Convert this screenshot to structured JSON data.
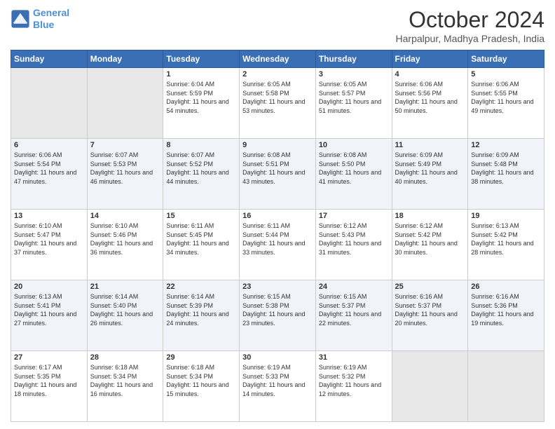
{
  "header": {
    "logo_line1": "General",
    "logo_line2": "Blue",
    "month": "October 2024",
    "location": "Harpalpur, Madhya Pradesh, India"
  },
  "weekdays": [
    "Sunday",
    "Monday",
    "Tuesday",
    "Wednesday",
    "Thursday",
    "Friday",
    "Saturday"
  ],
  "weeks": [
    [
      {
        "day": "",
        "info": ""
      },
      {
        "day": "",
        "info": ""
      },
      {
        "day": "1",
        "info": "Sunrise: 6:04 AM\nSunset: 5:59 PM\nDaylight: 11 hours and 54 minutes."
      },
      {
        "day": "2",
        "info": "Sunrise: 6:05 AM\nSunset: 5:58 PM\nDaylight: 11 hours and 53 minutes."
      },
      {
        "day": "3",
        "info": "Sunrise: 6:05 AM\nSunset: 5:57 PM\nDaylight: 11 hours and 51 minutes."
      },
      {
        "day": "4",
        "info": "Sunrise: 6:06 AM\nSunset: 5:56 PM\nDaylight: 11 hours and 50 minutes."
      },
      {
        "day": "5",
        "info": "Sunrise: 6:06 AM\nSunset: 5:55 PM\nDaylight: 11 hours and 49 minutes."
      }
    ],
    [
      {
        "day": "6",
        "info": "Sunrise: 6:06 AM\nSunset: 5:54 PM\nDaylight: 11 hours and 47 minutes."
      },
      {
        "day": "7",
        "info": "Sunrise: 6:07 AM\nSunset: 5:53 PM\nDaylight: 11 hours and 46 minutes."
      },
      {
        "day": "8",
        "info": "Sunrise: 6:07 AM\nSunset: 5:52 PM\nDaylight: 11 hours and 44 minutes."
      },
      {
        "day": "9",
        "info": "Sunrise: 6:08 AM\nSunset: 5:51 PM\nDaylight: 11 hours and 43 minutes."
      },
      {
        "day": "10",
        "info": "Sunrise: 6:08 AM\nSunset: 5:50 PM\nDaylight: 11 hours and 41 minutes."
      },
      {
        "day": "11",
        "info": "Sunrise: 6:09 AM\nSunset: 5:49 PM\nDaylight: 11 hours and 40 minutes."
      },
      {
        "day": "12",
        "info": "Sunrise: 6:09 AM\nSunset: 5:48 PM\nDaylight: 11 hours and 38 minutes."
      }
    ],
    [
      {
        "day": "13",
        "info": "Sunrise: 6:10 AM\nSunset: 5:47 PM\nDaylight: 11 hours and 37 minutes."
      },
      {
        "day": "14",
        "info": "Sunrise: 6:10 AM\nSunset: 5:46 PM\nDaylight: 11 hours and 36 minutes."
      },
      {
        "day": "15",
        "info": "Sunrise: 6:11 AM\nSunset: 5:45 PM\nDaylight: 11 hours and 34 minutes."
      },
      {
        "day": "16",
        "info": "Sunrise: 6:11 AM\nSunset: 5:44 PM\nDaylight: 11 hours and 33 minutes."
      },
      {
        "day": "17",
        "info": "Sunrise: 6:12 AM\nSunset: 5:43 PM\nDaylight: 11 hours and 31 minutes."
      },
      {
        "day": "18",
        "info": "Sunrise: 6:12 AM\nSunset: 5:42 PM\nDaylight: 11 hours and 30 minutes."
      },
      {
        "day": "19",
        "info": "Sunrise: 6:13 AM\nSunset: 5:42 PM\nDaylight: 11 hours and 28 minutes."
      }
    ],
    [
      {
        "day": "20",
        "info": "Sunrise: 6:13 AM\nSunset: 5:41 PM\nDaylight: 11 hours and 27 minutes."
      },
      {
        "day": "21",
        "info": "Sunrise: 6:14 AM\nSunset: 5:40 PM\nDaylight: 11 hours and 26 minutes."
      },
      {
        "day": "22",
        "info": "Sunrise: 6:14 AM\nSunset: 5:39 PM\nDaylight: 11 hours and 24 minutes."
      },
      {
        "day": "23",
        "info": "Sunrise: 6:15 AM\nSunset: 5:38 PM\nDaylight: 11 hours and 23 minutes."
      },
      {
        "day": "24",
        "info": "Sunrise: 6:15 AM\nSunset: 5:37 PM\nDaylight: 11 hours and 22 minutes."
      },
      {
        "day": "25",
        "info": "Sunrise: 6:16 AM\nSunset: 5:37 PM\nDaylight: 11 hours and 20 minutes."
      },
      {
        "day": "26",
        "info": "Sunrise: 6:16 AM\nSunset: 5:36 PM\nDaylight: 11 hours and 19 minutes."
      }
    ],
    [
      {
        "day": "27",
        "info": "Sunrise: 6:17 AM\nSunset: 5:35 PM\nDaylight: 11 hours and 18 minutes."
      },
      {
        "day": "28",
        "info": "Sunrise: 6:18 AM\nSunset: 5:34 PM\nDaylight: 11 hours and 16 minutes."
      },
      {
        "day": "29",
        "info": "Sunrise: 6:18 AM\nSunset: 5:34 PM\nDaylight: 11 hours and 15 minutes."
      },
      {
        "day": "30",
        "info": "Sunrise: 6:19 AM\nSunset: 5:33 PM\nDaylight: 11 hours and 14 minutes."
      },
      {
        "day": "31",
        "info": "Sunrise: 6:19 AM\nSunset: 5:32 PM\nDaylight: 11 hours and 12 minutes."
      },
      {
        "day": "",
        "info": ""
      },
      {
        "day": "",
        "info": ""
      }
    ]
  ]
}
